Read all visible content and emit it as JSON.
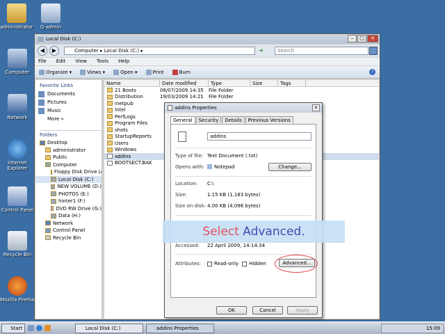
{
  "desktop": {
    "icons": [
      {
        "label": "administrator"
      },
      {
        "label": "G-admin"
      },
      {
        "label": "Computer"
      },
      {
        "label": "Network"
      },
      {
        "label": "Internet Explorer"
      },
      {
        "label": "Control Panel"
      },
      {
        "label": "Recycle Bin"
      },
      {
        "label": "Mozilla Firefox"
      }
    ]
  },
  "explorer": {
    "title": "Local Disk (C:)",
    "address": "Computer ▸ Local Disk (C:) ▸",
    "search_placeholder": "Search",
    "menu": [
      "File",
      "Edit",
      "View",
      "Tools",
      "Help"
    ],
    "toolbar": [
      "Organize ▾",
      "Views ▾",
      "Open ▾",
      "Print",
      "Burn"
    ],
    "favorite_links_title": "Favorite Links",
    "links": [
      "Documents",
      "Pictures",
      "Music",
      "More »"
    ],
    "folders_title": "Folders",
    "tree": [
      "Desktop",
      "administrator",
      "Public",
      "Computer",
      "Floppy Disk Drive (A:)",
      "Local Disk (C:)",
      "NEW VOLUME (D:)",
      "PHOTOS (E:)",
      "hinter1 (F:)",
      "DVD RW Drive (G:)",
      "Data (H:)",
      "Network",
      "Control Panel",
      "Recycle Bin"
    ],
    "columns": [
      "Name",
      "Date modified",
      "Type",
      "Size",
      "Tags"
    ],
    "files": [
      {
        "name": "21 Boots",
        "date": "06/07/2009 14:35",
        "type": "File Folder"
      },
      {
        "name": "Distribution",
        "date": "19/03/2009 14:21",
        "type": "File Folder"
      },
      {
        "name": "inetpub",
        "date": "",
        "type": ""
      },
      {
        "name": "Intel",
        "date": "",
        "type": ""
      },
      {
        "name": "PerfLogs",
        "date": "",
        "type": ""
      },
      {
        "name": "Program Files",
        "date": "",
        "type": ""
      },
      {
        "name": "shots",
        "date": "",
        "type": ""
      },
      {
        "name": "StartupReports",
        "date": "",
        "type": ""
      },
      {
        "name": "Users",
        "date": "",
        "type": ""
      },
      {
        "name": "Windows",
        "date": "",
        "type": ""
      },
      {
        "name": "addins",
        "date": "",
        "type": ""
      },
      {
        "name": "BOOTSECT.BAK",
        "date": "",
        "type": ""
      }
    ]
  },
  "props": {
    "title": "addins Properties",
    "tabs": [
      "General",
      "Security",
      "Details",
      "Previous Versions"
    ],
    "filename": "addins",
    "type_label": "Type of file:",
    "type_value": "Text Document (.txt)",
    "opens_label": "Opens with:",
    "opens_value": "Notepad",
    "change_label": "Change...",
    "location_label": "Location:",
    "location_value": "C:\\",
    "size_label": "Size:",
    "size_value": "1.15 KB (1,183 bytes)",
    "sizeondisk_label": "Size on disk:",
    "sizeondisk_value": "4.00 KB (4,096 bytes)",
    "accessed_label": "Accessed:",
    "accessed_value": "22 April 2009, 14:14:34",
    "attributes_label": "Attributes:",
    "readonly_label": "Read-only",
    "hidden_label": "Hidden",
    "advanced_label": "Advanced...",
    "ok_label": "OK",
    "cancel_label": "Cancel",
    "apply_label": "Apply"
  },
  "callout": {
    "word1": "Select",
    "word2": "Advanced."
  },
  "taskbar": {
    "start_label": "Start",
    "items": [
      "Local Disk (C:)",
      "addins Properties"
    ],
    "clock": "15:09"
  }
}
